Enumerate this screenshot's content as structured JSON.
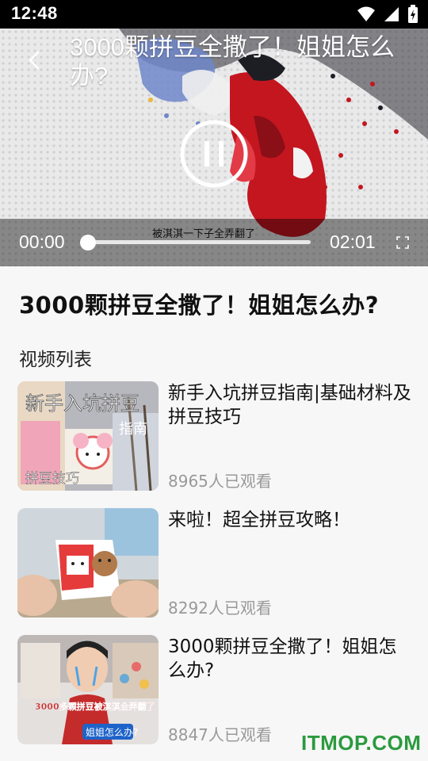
{
  "status_bar": {
    "time": "12:48",
    "icons": [
      "wifi-icon",
      "signal-icon",
      "battery-charging-icon"
    ]
  },
  "player": {
    "title": "3000颗拼豆全撒了！姐姐怎么办?",
    "subtitle": "被淇淇一下子全弄翻了",
    "current_time": "00:00",
    "total_time": "02:01",
    "progress": 0,
    "state": "playing",
    "icons": {
      "back": "back-arrow-icon",
      "toggle": "pause-icon",
      "fullscreen": "fullscreen-icon"
    }
  },
  "main": {
    "video_title": "3000颗拼豆全撒了！姐姐怎么办?",
    "list_label": "视频列表",
    "items": [
      {
        "title": "新手入坑拼豆指南|基础材料及拼豆技巧",
        "views": "8965人已观看",
        "thumb_text": "新手入坑拼豆",
        "thumb_sub": "指南",
        "thumb_tag": "拼豆技巧"
      },
      {
        "title": "来啦！超全拼豆攻略！",
        "views": "8292人已观看"
      },
      {
        "title": "3000颗拼豆全撒了！姐姐怎么办?",
        "views": "8847人已观看",
        "thumb_caption": "3000多颗拼豆被淇淇全弄翻了",
        "thumb_tag": "姐姐怎么办?"
      }
    ]
  },
  "watermark": "ITMOP.COM",
  "colors": {
    "accent_green": "#2b9a3e",
    "muted_text": "#999999",
    "status_bar": "#000000"
  }
}
